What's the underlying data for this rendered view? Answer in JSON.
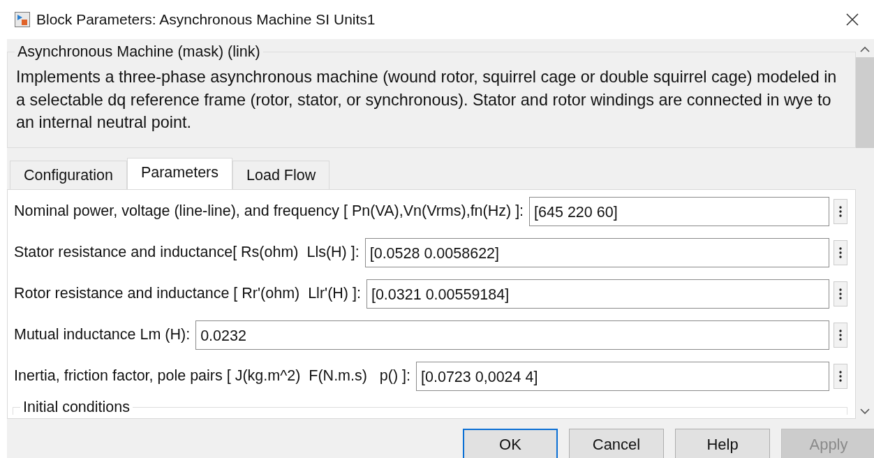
{
  "window": {
    "title": "Block Parameters: Asynchronous Machine SI Units1"
  },
  "description": {
    "heading": "Asynchronous Machine (mask) (link)",
    "text": "Implements a three-phase asynchronous machine (wound rotor, squirrel cage or double squirrel cage) modeled in a selectable dq reference frame (rotor, stator, or synchronous). Stator and rotor windings are connected in wye to an internal neutral point."
  },
  "tabs": [
    {
      "label": "Configuration",
      "selected": false
    },
    {
      "label": "Parameters",
      "selected": true
    },
    {
      "label": "Load Flow",
      "selected": false
    }
  ],
  "parameters": [
    {
      "label": "Nominal power, voltage (line-line), and frequency [ Pn(VA),Vn(Vrms),fn(Hz) ]:",
      "value": "[645 220 60]"
    },
    {
      "label": "Stator resistance and inductance[ Rs(ohm)  Lls(H) ]:",
      "value": "[0.0528 0.0058622]"
    },
    {
      "label": "Rotor resistance and inductance [ Rr'(ohm)  Llr'(H) ]:",
      "value": "[0.0321 0.00559184]"
    },
    {
      "label": "Mutual inductance Lm (H):",
      "value": "0.0232"
    },
    {
      "label": "Inertia, friction factor, pole pairs [ J(kg.m^2)  F(N.m.s)   p() ]:",
      "value": "[0.0723 0,0024 4]"
    }
  ],
  "group": {
    "heading": "Initial conditions"
  },
  "buttons": [
    {
      "label": "OK",
      "default": true,
      "disabled": false
    },
    {
      "label": "Cancel",
      "default": false,
      "disabled": false
    },
    {
      "label": "Help",
      "default": false,
      "disabled": false
    },
    {
      "label": "Apply",
      "default": false,
      "disabled": true
    }
  ]
}
